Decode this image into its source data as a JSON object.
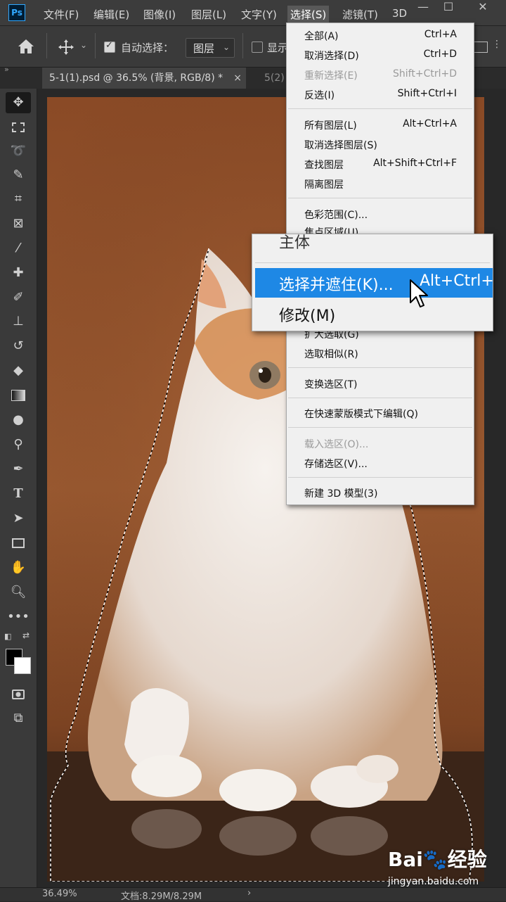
{
  "menubar": {
    "logo": "Ps",
    "items": [
      "文件(F)",
      "编辑(E)",
      "图像(I)",
      "图层(L)",
      "文字(Y)",
      "选择(S)",
      "滤镜(T)",
      "3D"
    ],
    "active_index": 5
  },
  "options": {
    "auto_select_label": "自动选择：",
    "auto_select_value": "图层",
    "show_label": "显示"
  },
  "tabs": [
    {
      "label": "5-1(1).psd @ 36.5% (背景, RGB/8) *",
      "close": "×"
    },
    {
      "label": "5(2)"
    }
  ],
  "select_menu": {
    "items": [
      {
        "label": "全部(A)",
        "shortcut": "Ctrl+A",
        "disabled": false
      },
      {
        "label": "取消选择(D)",
        "shortcut": "Ctrl+D",
        "disabled": false
      },
      {
        "label": "重新选择(E)",
        "shortcut": "Shift+Ctrl+D",
        "disabled": true
      },
      {
        "label": "反选(I)",
        "shortcut": "Shift+Ctrl+I",
        "disabled": false
      },
      {
        "label": "所有图层(L)",
        "shortcut": "Alt+Ctrl+A",
        "disabled": false
      },
      {
        "label": "取消选择图层(S)",
        "shortcut": "",
        "disabled": false
      },
      {
        "label": "查找图层",
        "shortcut": "Alt+Shift+Ctrl+F",
        "disabled": false
      },
      {
        "label": "隔离图层",
        "shortcut": "",
        "disabled": false
      },
      {
        "label": "色彩范围(C)...",
        "shortcut": "",
        "disabled": false
      },
      {
        "label": "焦点区域(U)...",
        "shortcut": "",
        "disabled": false
      },
      {
        "label": "扩大选取(G)",
        "shortcut": "",
        "disabled": false
      },
      {
        "label": "选取相似(R)",
        "shortcut": "",
        "disabled": false
      },
      {
        "label": "变换选区(T)",
        "shortcut": "",
        "disabled": false
      },
      {
        "label": "在快速蒙版模式下编辑(Q)",
        "shortcut": "",
        "disabled": false
      },
      {
        "label": "载入选区(O)...",
        "shortcut": "",
        "disabled": true
      },
      {
        "label": "存储选区(V)...",
        "shortcut": "",
        "disabled": false
      },
      {
        "label": "新建 3D 模型(3)",
        "shortcut": "",
        "disabled": false
      }
    ]
  },
  "zoom_menu": {
    "items": [
      {
        "label": "主体",
        "shortcut": ""
      },
      {
        "label": "选择并遮住(K)...",
        "shortcut": "Alt+Ctrl+R",
        "highlighted": true
      },
      {
        "label": "修改(M)",
        "shortcut": ""
      }
    ]
  },
  "status": {
    "zoom": "36.49%",
    "doc": "文档:8.29M/8.29M",
    "arrow": "›"
  },
  "watermark": {
    "brand": "Bai🐾经验",
    "url": "jingyan.baidu.com"
  }
}
